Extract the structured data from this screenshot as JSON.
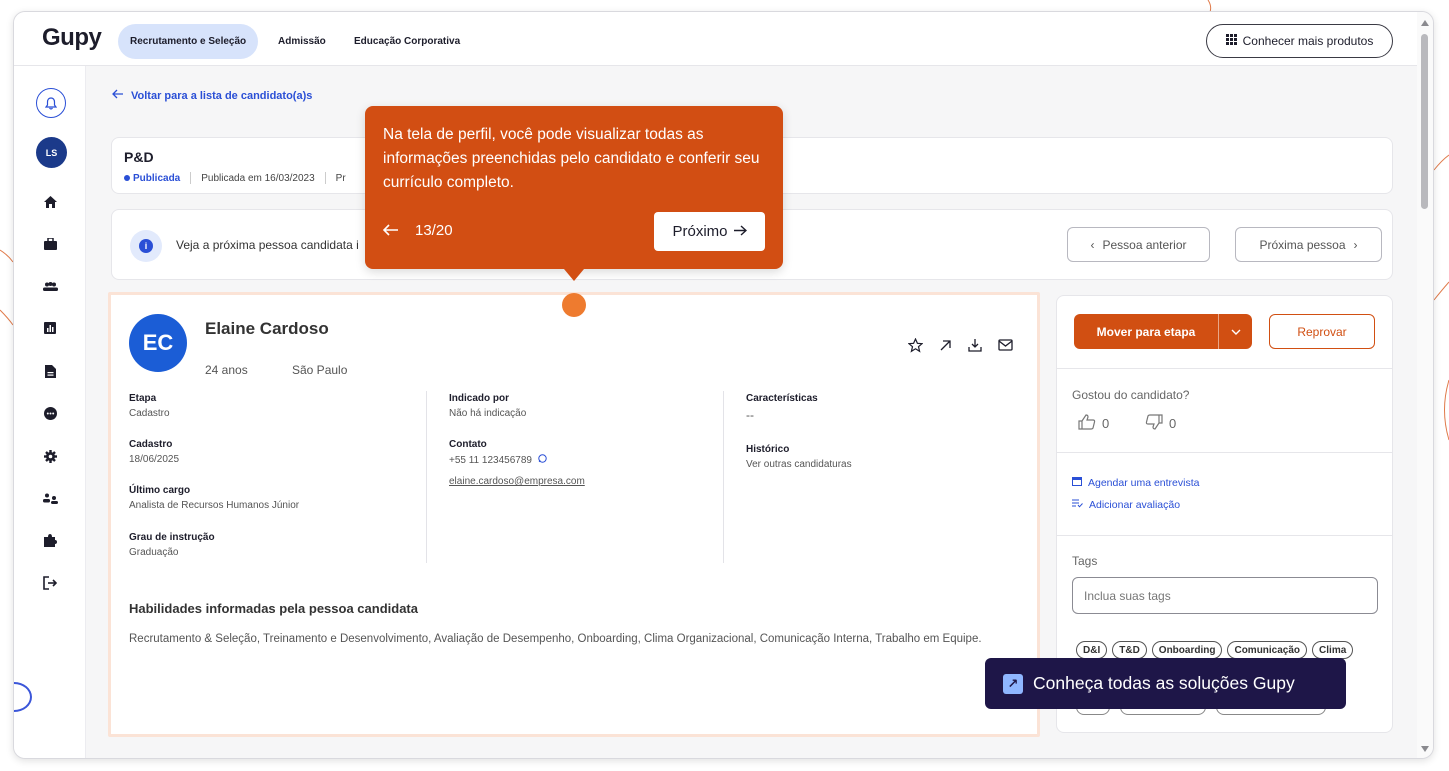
{
  "app": {
    "logo": "Gupy",
    "nav_tabs": [
      "Recrutamento e Seleção",
      "Admissão",
      "Educação Corporativa"
    ],
    "products_button": "Conhecer mais produtos"
  },
  "sidebar": {
    "avatar_initials": "LS",
    "icons": [
      "bell-icon",
      "home-icon",
      "briefcase-icon",
      "people-icon",
      "chart-icon",
      "document-icon",
      "chat-icon",
      "settings-icon",
      "team-icon",
      "puzzle-icon",
      "logout-icon"
    ]
  },
  "back_link": "Voltar para a lista de candidato(a)s",
  "job": {
    "title": "P&D",
    "status": "Publicada",
    "published_date": "Publicada em 16/03/2023",
    "extra": "Pr"
  },
  "next_person": {
    "text": "Veja a próxima pessoa candidata i",
    "prev_button": "Pessoa anterior",
    "next_button": "Próxima pessoa"
  },
  "candidate": {
    "initials": "EC",
    "name": "Elaine Cardoso",
    "age": "24 anos",
    "city": "São Paulo",
    "fields": {
      "etapa_label": "Etapa",
      "etapa": "Cadastro",
      "cadastro_label": "Cadastro",
      "cadastro": "18/06/2025",
      "ultimo_cargo_label": "Último cargo",
      "ultimo_cargo": "Analista de Recursos Humanos Júnior",
      "grau_label": "Grau de instrução",
      "grau": "Graduação",
      "indicado_label": "Indicado por",
      "indicado": "Não há indicação",
      "contato_label": "Contato",
      "telefone": "+55 11 123456789",
      "email": "elaine.cardoso@empresa.com",
      "caracteristicas_label": "Características",
      "caracteristicas": "--",
      "historico_label": "Histórico",
      "historico_link": "Ver outras candidaturas"
    },
    "skills_title": "Habilidades informadas pela pessoa candidata",
    "skills": "Recrutamento & Seleção, Treinamento e Desenvolvimento, Avaliação de Desempenho, Onboarding, Clima Organizacional, Comunicação Interna, Trabalho em Equipe."
  },
  "right_panel": {
    "move_button": "Mover para etapa",
    "reject_button": "Reprovar",
    "liked_question": "Gostou do candidato?",
    "likes": "0",
    "dislikes": "0",
    "schedule_link": "Agendar uma entrevista",
    "evaluation_link": "Adicionar avaliação",
    "tags_label": "Tags",
    "tags_placeholder": "Inclua suas tags",
    "tags": [
      "D&I",
      "T&D",
      "Onboarding",
      "Comunicação",
      "Clima"
    ]
  },
  "tour": {
    "text": "Na tela de perfil, você pode visualizar todas as informações preenchidas pelo candidato e conferir seu currículo completo.",
    "counter": "13/20",
    "next_button": "Próximo"
  },
  "banner": {
    "text": "Conheça todas as soluções Gupy"
  },
  "colors": {
    "accent": "#d14f12",
    "primary_blue": "#2a4fd6",
    "tour_bg": "#d24e13",
    "banner_bg": "#1e1648"
  }
}
